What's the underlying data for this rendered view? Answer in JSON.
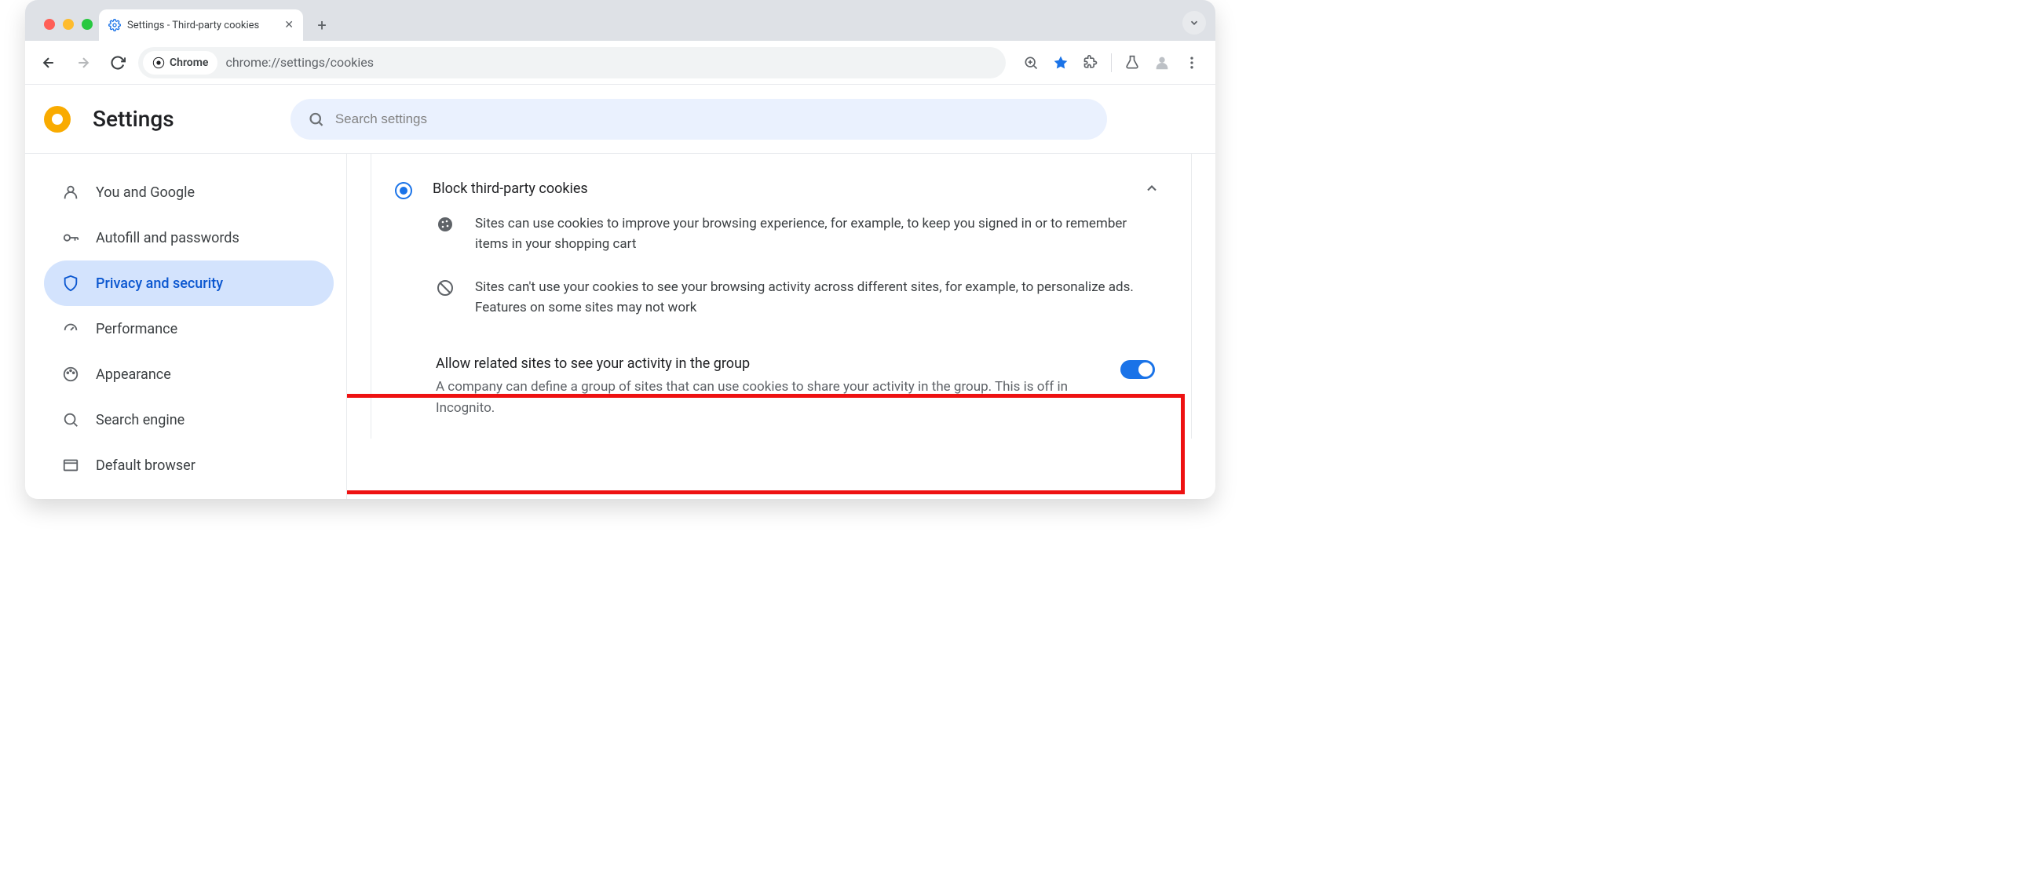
{
  "tab": {
    "title": "Settings - Third-party cookies"
  },
  "addr": {
    "chip": "Chrome",
    "url": "chrome://settings/cookies"
  },
  "header": {
    "title": "Settings"
  },
  "search": {
    "placeholder": "Search settings"
  },
  "sidebar": {
    "items": [
      {
        "label": "You and Google"
      },
      {
        "label": "Autofill and passwords"
      },
      {
        "label": "Privacy and security"
      },
      {
        "label": "Performance"
      },
      {
        "label": "Appearance"
      },
      {
        "label": "Search engine"
      },
      {
        "label": "Default browser"
      }
    ]
  },
  "main": {
    "radio_title": "Block third-party cookies",
    "sub1": "Sites can use cookies to improve your browsing experience, for example, to keep you signed in or to remember items in your shopping cart",
    "sub2": "Sites can't use your cookies to see your browsing activity across different sites, for example, to personalize ads. Features on some sites may not work",
    "toggle_title": "Allow related sites to see your activity in the group",
    "toggle_desc": "A company can define a group of sites that can use cookies to share your activity in the group. This is off in Incognito."
  }
}
